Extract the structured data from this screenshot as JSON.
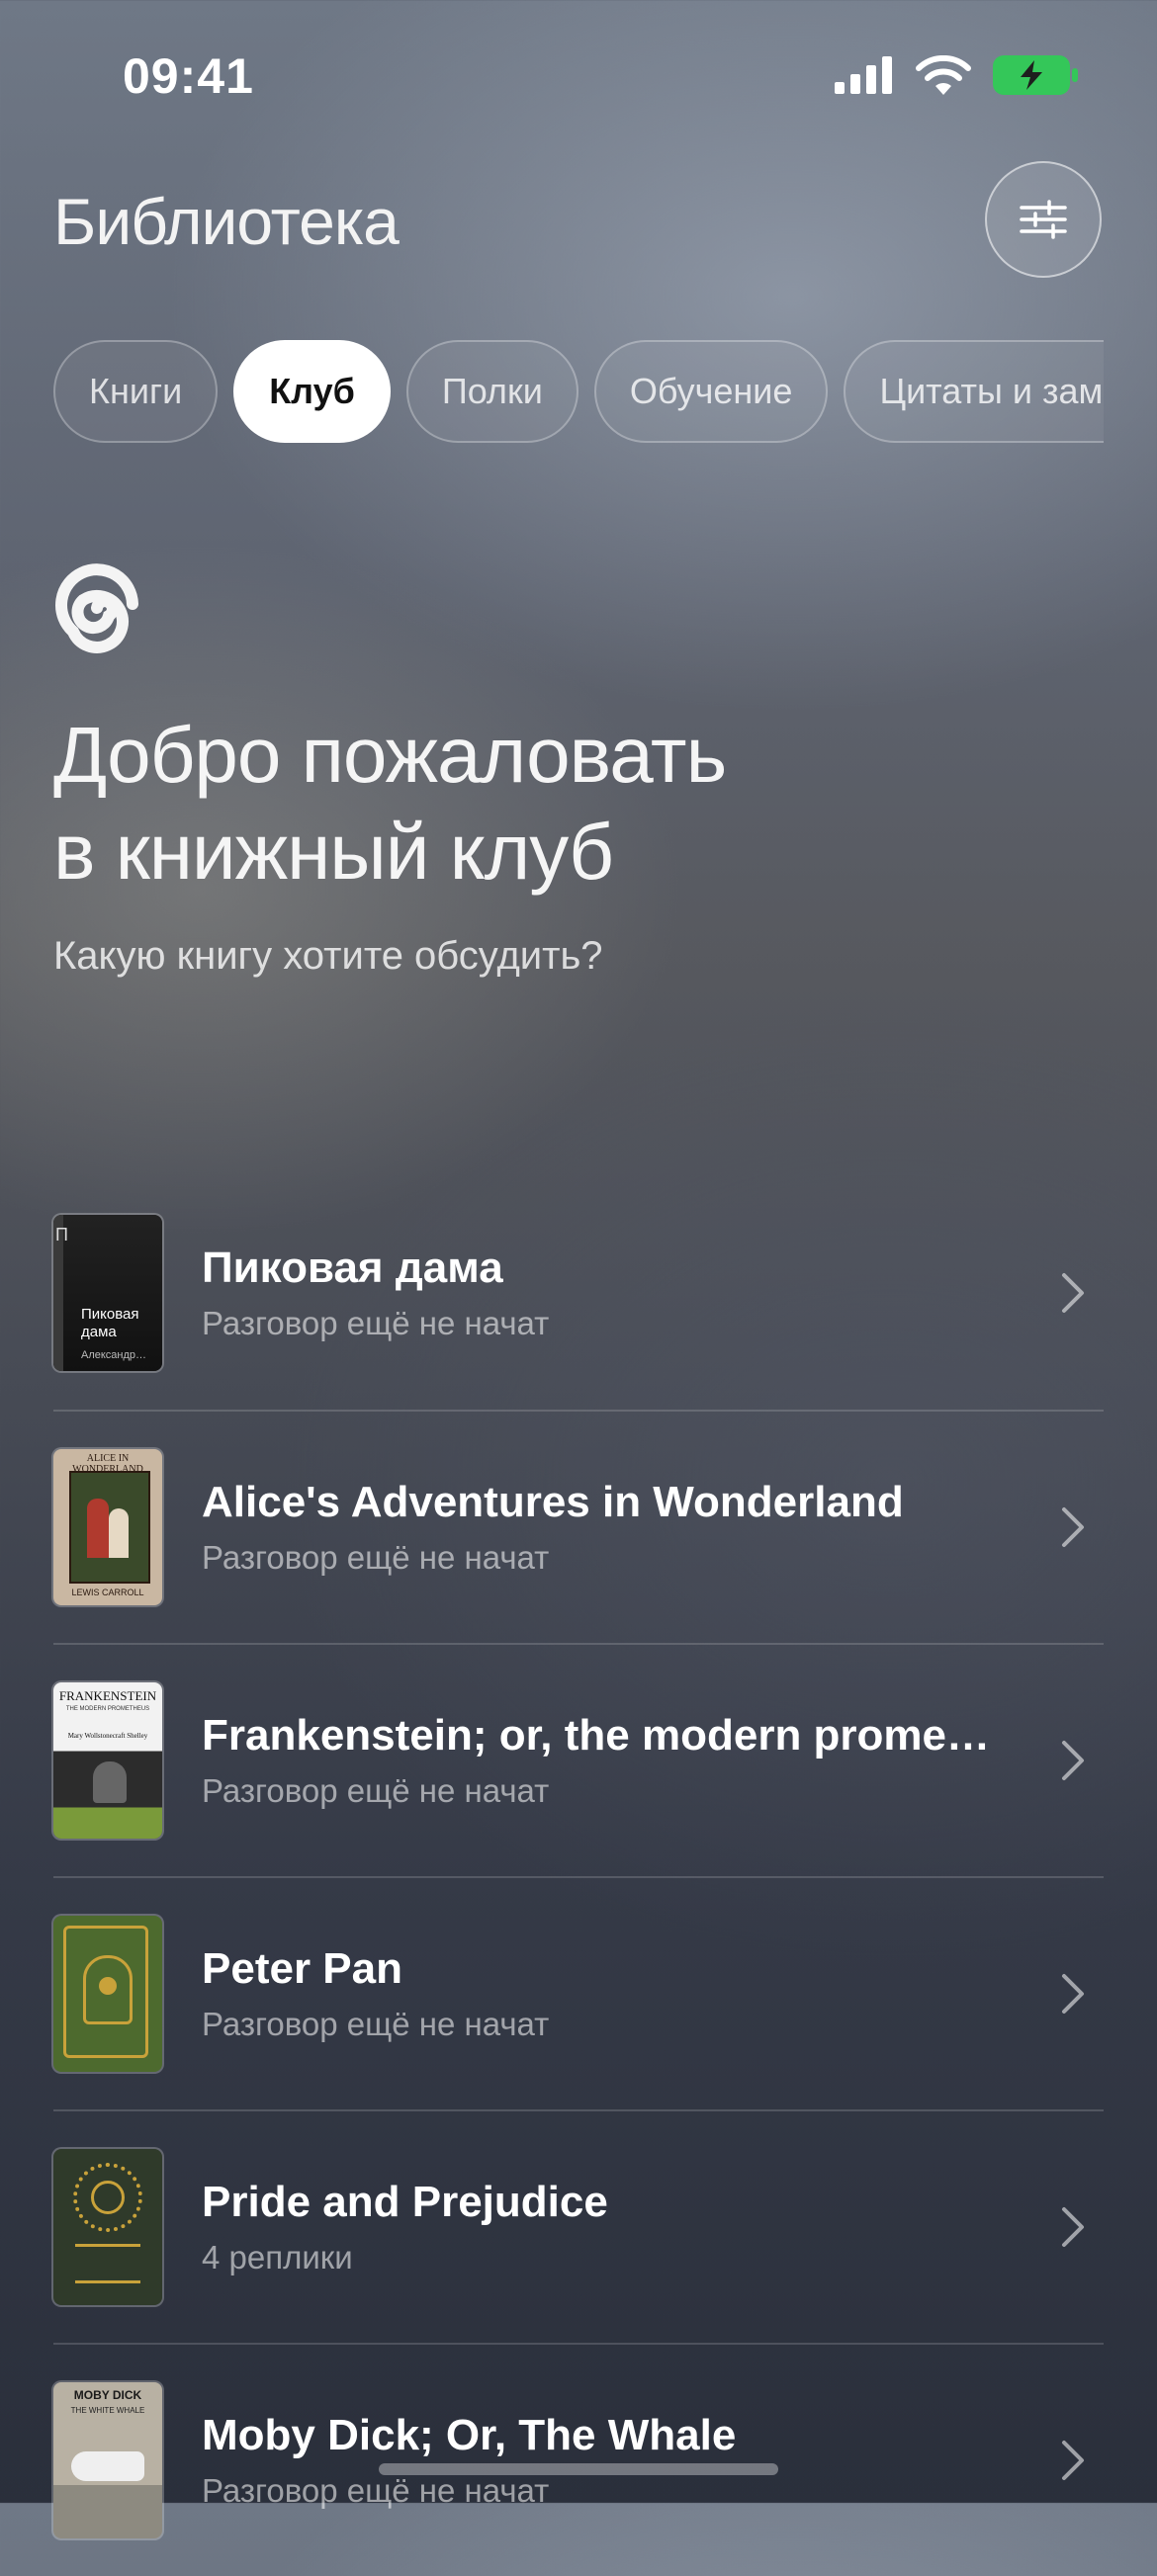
{
  "status_bar": {
    "time": "09:41"
  },
  "header": {
    "title": "Библиотека"
  },
  "tabs": [
    {
      "label": "Книги"
    },
    {
      "label": "Клуб"
    },
    {
      "label": "Полки"
    },
    {
      "label": "Обучение"
    },
    {
      "label": "Цитаты и заметки"
    }
  ],
  "club": {
    "welcome_line1": "Добро пожаловать",
    "welcome_line2": "в книжный клуб",
    "subtitle": "Какую книгу хотите обсудить?"
  },
  "books": [
    {
      "title": "Пиковая дама",
      "status": "Разговор ещё не начат",
      "cover_title": "Пиковая дама",
      "cover_author": "Александр…",
      "cover_spine": "П"
    },
    {
      "title": "Alice's Adventures in Wonderland",
      "status": "Разговор ещё не начат",
      "cover_title": "ALICE IN WONDERLAND",
      "cover_author": "LEWIS CARROLL"
    },
    {
      "title": "Frankenstein; or, the modern promet…",
      "status": "Разговор ещё не начат",
      "cover_title": "FRANKENSTEIN",
      "cover_subtitle": "THE MODERN PROMETHEUS",
      "cover_author": "Mary Wollstonecraft Shelley"
    },
    {
      "title": "Peter Pan",
      "status": "Разговор ещё не начат"
    },
    {
      "title": "Pride and Prejudice",
      "status": "4 реплики"
    },
    {
      "title": "Moby Dick; Or, The Whale",
      "status": "Разговор ещё не начат",
      "cover_title": "MOBY DICK",
      "cover_subtitle": "THE WHITE WHALE"
    }
  ],
  "colors": {
    "accent_white": "#ffffff",
    "battery_green": "#34c759"
  }
}
